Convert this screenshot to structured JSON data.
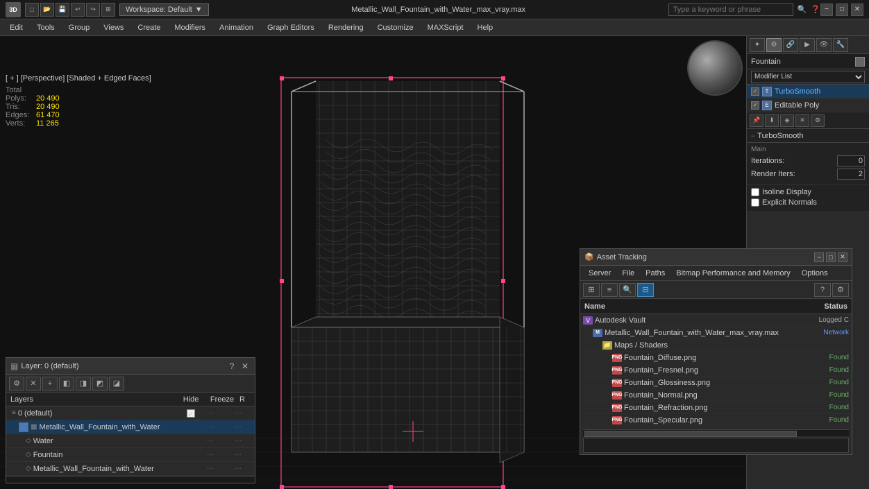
{
  "titlebar": {
    "logo": "3D",
    "title": "Metallic_Wall_Fountain_with_Water_max_vray.max",
    "workspace_label": "Workspace: Default",
    "search_placeholder": "Type a keyword or phrase",
    "win_min": "−",
    "win_max": "□",
    "win_close": "✕"
  },
  "menubar": {
    "items": [
      "Edit",
      "Tools",
      "Group",
      "Views",
      "Create",
      "Modifiers",
      "Animation",
      "Graph Editors",
      "Rendering",
      "Customize",
      "MAXScript",
      "Help"
    ]
  },
  "viewport": {
    "label": "[ + ] [Perspective] [Shaded + Edged Faces]",
    "stats": {
      "header": "Total",
      "rows": [
        {
          "key": "Polys:",
          "val": "20 490"
        },
        {
          "key": "Tris:",
          "val": "20 490"
        },
        {
          "key": "Edges:",
          "val": "61 470"
        },
        {
          "key": "Verts:",
          "val": "11 265"
        }
      ]
    }
  },
  "right_panel": {
    "object_name": "Fountain",
    "modifier_list_label": "Modifier List",
    "modifiers": [
      {
        "name": "TurboSmooth",
        "active": true
      },
      {
        "name": "Editable Poly",
        "active": false
      }
    ],
    "turbosmooth": {
      "label": "TurboSmooth",
      "main_label": "Main",
      "iterations_label": "Iterations:",
      "iterations_val": "0",
      "render_iters_label": "Render Iters:",
      "render_iters_val": "2",
      "isoline_label": "Isoline Display",
      "explicit_label": "Explicit Normals"
    }
  },
  "layer_panel": {
    "title": "Layer: 0 (default)",
    "help_btn": "?",
    "close_btn": "✕",
    "col_name": "Layers",
    "col_hide": "Hide",
    "col_freeze": "Freeze",
    "col_render": "R",
    "rows": [
      {
        "indent": 0,
        "type": "layer",
        "name": "0 (default)",
        "checked": true,
        "hide": "···",
        "freeze": "···"
      },
      {
        "indent": 1,
        "type": "group",
        "name": "Metallic_Wall_Fountain_with_Water",
        "checked": false,
        "has_swatch": true,
        "hide": "···",
        "freeze": "···"
      },
      {
        "indent": 2,
        "type": "item",
        "name": "Water",
        "hide": "···",
        "freeze": "···"
      },
      {
        "indent": 2,
        "type": "item",
        "name": "Fountain",
        "hide": "···",
        "freeze": "···"
      },
      {
        "indent": 2,
        "type": "item",
        "name": "Metallic_Wall_Fountain_with_Water",
        "hide": "···",
        "freeze": "···"
      }
    ]
  },
  "asset_tracking": {
    "title": "Asset Tracking",
    "win_min": "−",
    "win_max": "□",
    "win_close": "✕",
    "menu": [
      "Server",
      "File",
      "Paths",
      "Bitmap Performance and Memory",
      "Options"
    ],
    "col_name": "Name",
    "col_status": "Status",
    "rows": [
      {
        "indent": 0,
        "icon": "vault",
        "name": "Autodesk Vault",
        "status": "Logged C",
        "status_class": "logged"
      },
      {
        "indent": 1,
        "icon": "max",
        "name": "Metallic_Wall_Fountain_with_Water_max_vray.max",
        "status": "Network",
        "status_class": "network"
      },
      {
        "indent": 2,
        "icon": "folder",
        "name": "Maps / Shaders",
        "status": "",
        "status_class": ""
      },
      {
        "indent": 3,
        "icon": "png",
        "name": "Fountain_Diffuse.png",
        "status": "Found",
        "status_class": "found"
      },
      {
        "indent": 3,
        "icon": "png",
        "name": "Fountain_Fresnel.png",
        "status": "Found",
        "status_class": "found"
      },
      {
        "indent": 3,
        "icon": "png",
        "name": "Fountain_Glossiness.png",
        "status": "Found",
        "status_class": "found"
      },
      {
        "indent": 3,
        "icon": "png",
        "name": "Fountain_Normal.png",
        "status": "Found",
        "status_class": "found"
      },
      {
        "indent": 3,
        "icon": "png",
        "name": "Fountain_Refraction.png",
        "status": "Found",
        "status_class": "found"
      },
      {
        "indent": 3,
        "icon": "png",
        "name": "Fountain_Specular.png",
        "status": "Found",
        "status_class": "found"
      }
    ]
  }
}
